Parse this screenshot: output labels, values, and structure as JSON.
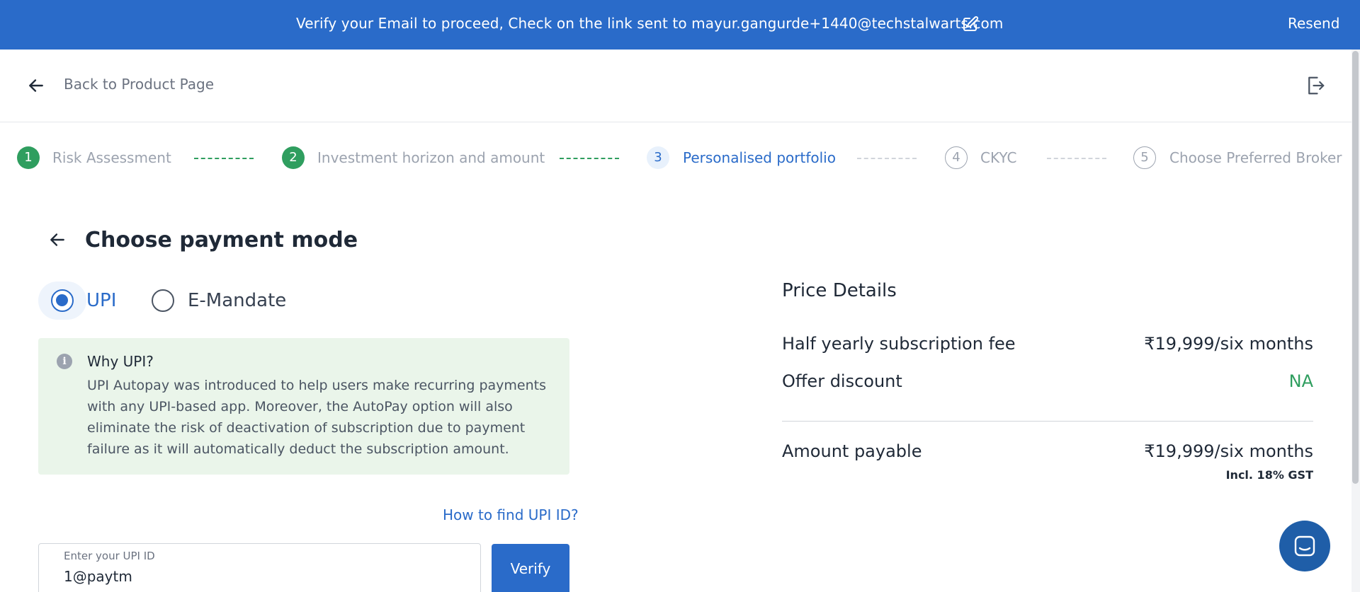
{
  "banner": {
    "message": "Verify your Email to proceed, Check on the link sent to mayur.gangurde+1440@techstalwarts.com",
    "resend_label": "Resend"
  },
  "header": {
    "back_label": "Back to Product Page"
  },
  "stepper": {
    "steps": [
      {
        "number": "1",
        "label": "Risk Assessment",
        "state": "done"
      },
      {
        "number": "2",
        "label": "Investment horizon and amount",
        "state": "done"
      },
      {
        "number": "3",
        "label": "Personalised portfolio",
        "state": "active"
      },
      {
        "number": "4",
        "label": "CKYC",
        "state": "todo"
      },
      {
        "number": "5",
        "label": "Choose Preferred Broker",
        "state": "todo"
      }
    ]
  },
  "payment": {
    "title": "Choose payment mode",
    "options": [
      {
        "label": "UPI",
        "selected": true
      },
      {
        "label": "E-Mandate",
        "selected": false
      }
    ],
    "info": {
      "title": "Why UPI?",
      "body": "UPI Autopay was introduced to help users make recurring payments with any UPI-based app. Moreover, the AutoPay option will also eliminate the risk of deactivation of subscription due to payment failure as it will automatically deduct the subscription amount."
    },
    "how_to_find_label": "How to find UPI ID?",
    "upi_field": {
      "label": "Enter your UPI ID",
      "value": "1@paytm"
    },
    "verify_label": "Verify"
  },
  "price_details": {
    "title": "Price Details",
    "rows": [
      {
        "label": "Half yearly subscription fee",
        "value": "₹19,999/six months"
      },
      {
        "label": "Offer discount",
        "value": "NA"
      }
    ],
    "total": {
      "label": "Amount payable",
      "value": "₹19,999/six months",
      "note": "Incl. 18% GST"
    }
  },
  "colors": {
    "primary": "#2a6bc9",
    "success": "#2f9e5f",
    "info_bg": "#eaf5ea"
  }
}
